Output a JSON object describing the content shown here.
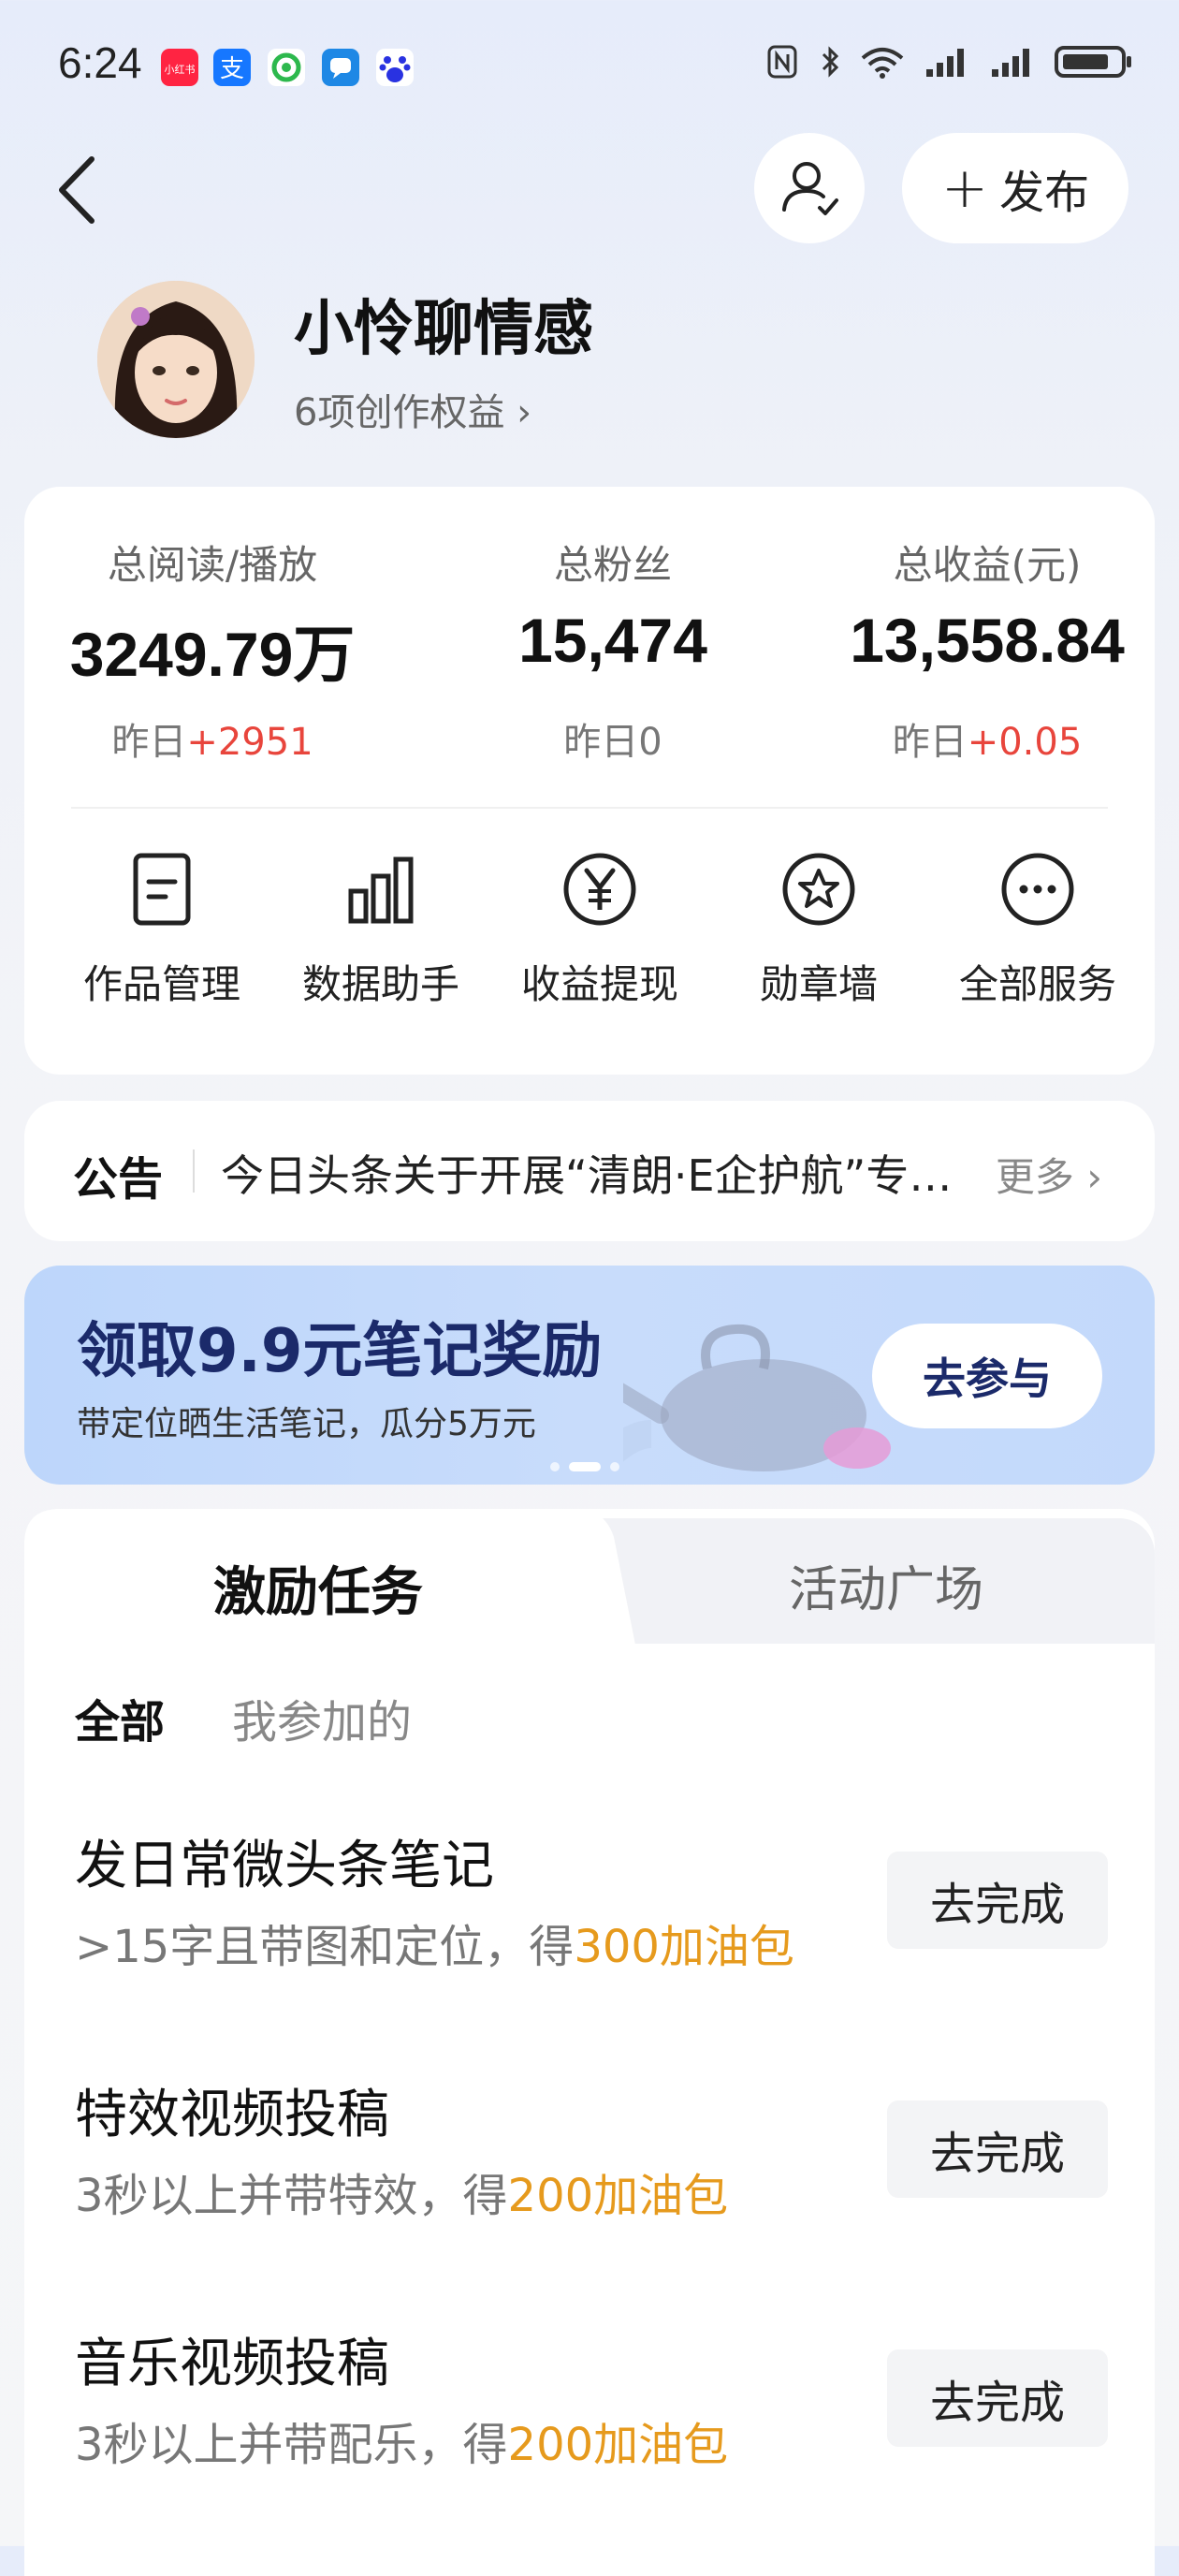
{
  "status_bar": {
    "time": "6:24",
    "notifications": [
      {
        "name": "xiaohongshu-icon",
        "color": "#ff2442",
        "glyph": "小红书"
      },
      {
        "name": "alipay-icon",
        "color": "#1677ff",
        "glyph": "支"
      },
      {
        "name": "app-green-icon",
        "color": "#2db84d",
        "glyph": "◎"
      },
      {
        "name": "message-icon",
        "color": "#1e88e5",
        "glyph": "💬"
      },
      {
        "name": "baidu-icon",
        "color": "#2932e1",
        "glyph": "度"
      }
    ]
  },
  "header": {
    "publish_label": "发布"
  },
  "profile": {
    "name": "小怜聊情感",
    "rights": "6项创作权益 ›"
  },
  "stats": [
    {
      "label": "总阅读/播放",
      "value": "3249.79万",
      "delta_prefix": "昨日",
      "delta": "+2951"
    },
    {
      "label": "总粉丝",
      "value": "15,474",
      "delta_prefix": "昨日",
      "delta": "0"
    },
    {
      "label": "总收益(元)",
      "value": "13,558.84",
      "delta_prefix": "昨日",
      "delta": "+0.05"
    }
  ],
  "services": [
    {
      "label": "作品管理",
      "icon": "document-icon"
    },
    {
      "label": "数据助手",
      "icon": "bar-chart-icon"
    },
    {
      "label": "收益提现",
      "icon": "yen-icon"
    },
    {
      "label": "勋章墙",
      "icon": "badge-icon"
    },
    {
      "label": "全部服务",
      "icon": "more-icon"
    }
  ],
  "notice": {
    "label": "公告",
    "text": "今日头条关于开展“清朗·E企护航”专项行动的公告",
    "more": "更多 ›"
  },
  "banner": {
    "title": "领取9.9元笔记奖励",
    "subtitle": "带定位晒生活笔记，瓜分5万元",
    "button": "去参与"
  },
  "tabs": {
    "active": "激励任务",
    "other": "活动广场"
  },
  "filters": {
    "all": "全部",
    "mine": "我参加的"
  },
  "tasks": [
    {
      "title": "发日常微头条笔记",
      "desc": ">15字且带图和定位，得",
      "reward": "300加油包",
      "button": "去完成"
    },
    {
      "title": "特效视频投稿",
      "desc": "3秒以上并带特效，得",
      "reward": "200加油包",
      "button": "去完成"
    },
    {
      "title": "音乐视频投稿",
      "desc": "3秒以上并带配乐，得",
      "reward": "200加油包",
      "button": "去完成"
    }
  ]
}
